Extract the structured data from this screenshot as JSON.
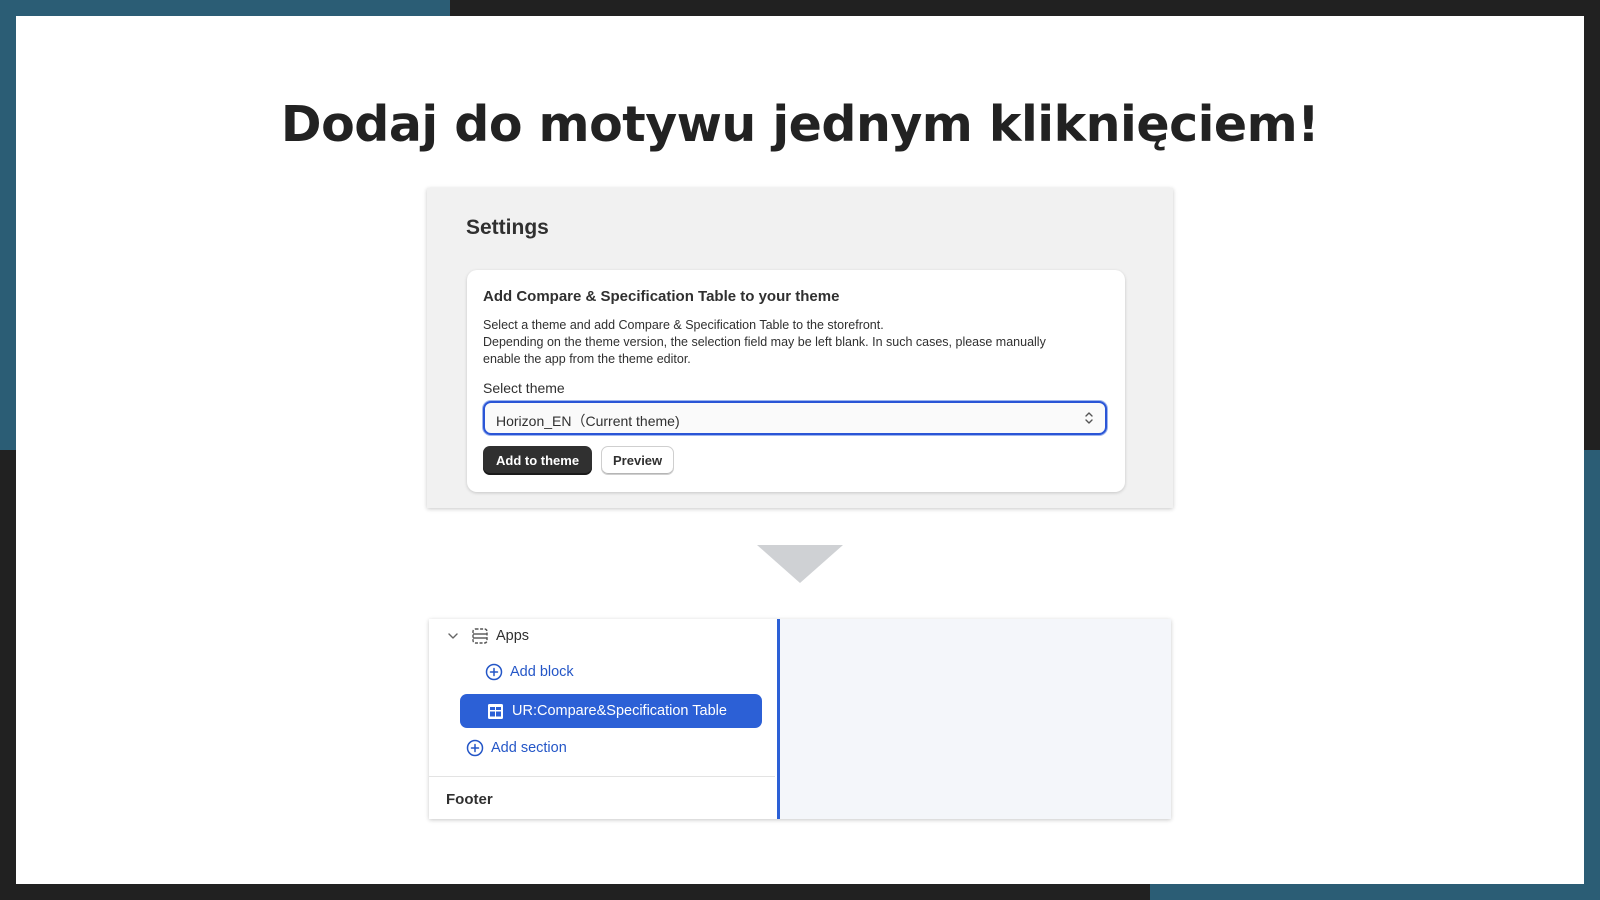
{
  "slide": {
    "title": "Dodaj do motywu jednym kliknięciem!"
  },
  "settings": {
    "heading": "Settings",
    "card": {
      "title": "Add Compare & Specification Table to your theme",
      "description_lines": [
        "Select a theme and add Compare & Specification Table to the storefront.",
        "Depending on the theme version, the selection field may be left blank. In such cases, please manually",
        "enable the app from the theme editor."
      ],
      "select_label": "Select theme",
      "select_value": "Horizon_EN（Current theme)",
      "add_button": "Add to theme",
      "preview_button": "Preview"
    }
  },
  "editor": {
    "apps_label": "Apps",
    "add_block": "Add block",
    "selected_block": "UR:Compare&Specification Table",
    "add_section": "Add section",
    "footer": "Footer"
  },
  "colors": {
    "frame": "#212121",
    "accent": "#2b5d75",
    "primary_blue": "#2c60d6",
    "link_blue": "#2456c7"
  }
}
